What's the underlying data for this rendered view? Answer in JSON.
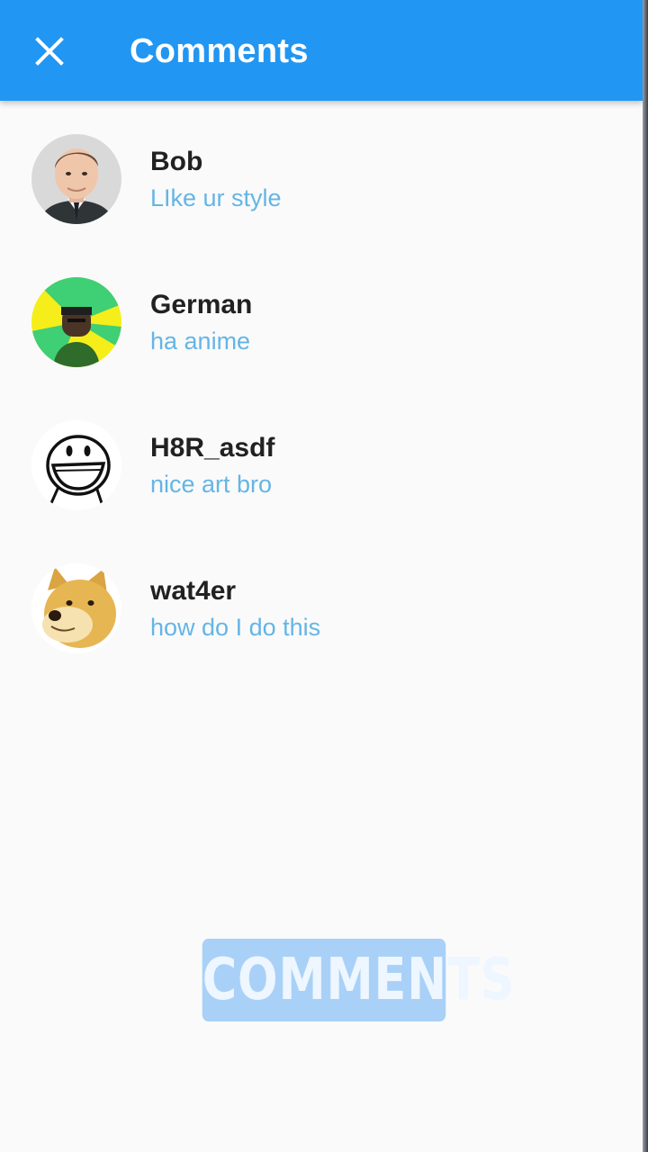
{
  "appbar": {
    "title": "Comments",
    "close_icon": "close-icon",
    "color": "#2196f3"
  },
  "comments": [
    {
      "username": "Bob",
      "text": "LIke ur style",
      "avatar_icon": "man-portrait-avatar"
    },
    {
      "username": "German",
      "text": "ha anime",
      "avatar_icon": "meme-character-avatar"
    },
    {
      "username": "H8R_asdf",
      "text": "nice art bro",
      "avatar_icon": "smiley-face-avatar"
    },
    {
      "username": "wat4er",
      "text": "how do I do this",
      "avatar_icon": "doge-avatar"
    }
  ],
  "watermark": {
    "text": "COMMENTS"
  },
  "colors": {
    "comment_text": "#64b5e6",
    "username_text": "#212121",
    "background": "#fafafa"
  }
}
